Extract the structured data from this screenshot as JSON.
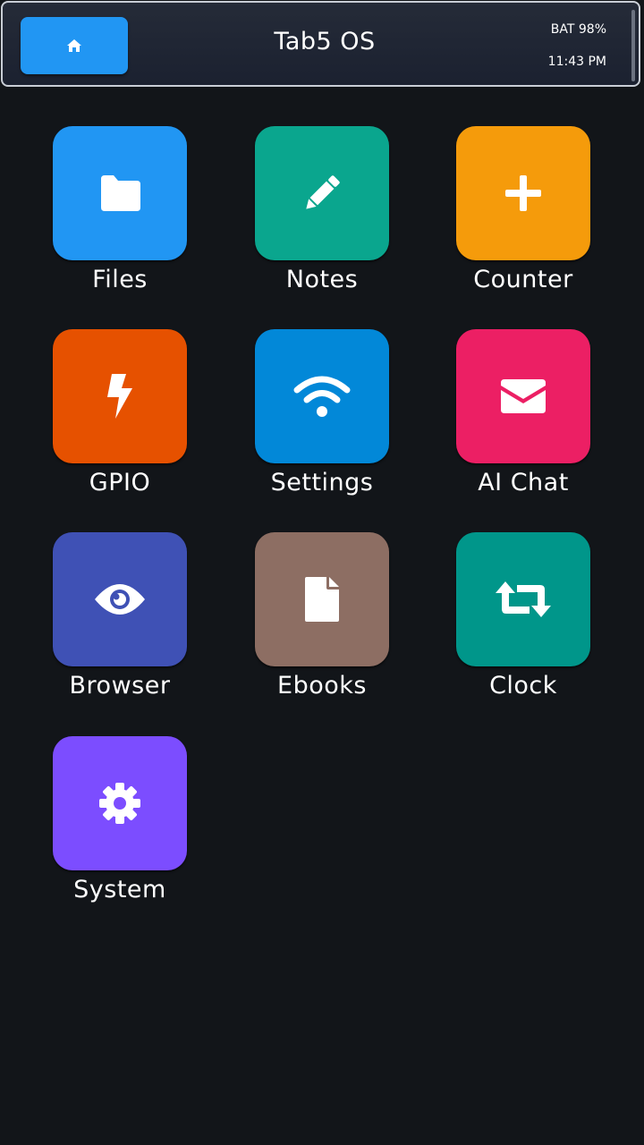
{
  "header": {
    "home_icon": "home-icon",
    "title": "Tab5 OS",
    "battery": "BAT 98%",
    "time": "11:43 PM"
  },
  "apps": [
    {
      "label": "Files",
      "icon": "folder-icon",
      "color": "#2196f3"
    },
    {
      "label": "Notes",
      "icon": "pencil-icon",
      "color": "#0aa68e"
    },
    {
      "label": "Counter",
      "icon": "plus-icon",
      "color": "#f59b0b"
    },
    {
      "label": "GPIO",
      "icon": "lightning-icon",
      "color": "#e65100"
    },
    {
      "label": "Settings",
      "icon": "wifi-icon",
      "color": "#0288d8"
    },
    {
      "label": "AI Chat",
      "icon": "envelope-icon",
      "color": "#ec1f64"
    },
    {
      "label": "Browser",
      "icon": "eye-icon",
      "color": "#3f51b5"
    },
    {
      "label": "Ebooks",
      "icon": "file-icon",
      "color": "#8d6e63"
    },
    {
      "label": "Clock",
      "icon": "loop-icon",
      "color": "#00968a"
    },
    {
      "label": "System",
      "icon": "gear-icon",
      "color": "#7c4dff"
    }
  ]
}
